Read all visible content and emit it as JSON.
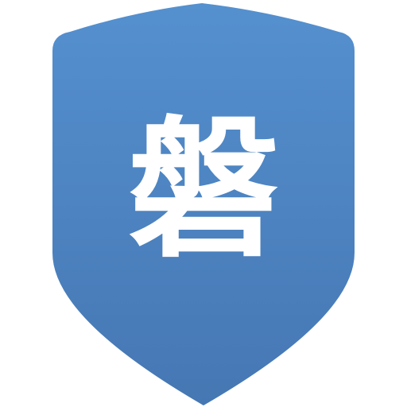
{
  "icon": {
    "name": "shield-app-icon",
    "glyph": "磐",
    "colors": {
      "shield_top": "#5590cf",
      "shield_bottom": "#4577b3",
      "glyph": "#ffffff",
      "background": "#ffffff"
    }
  }
}
